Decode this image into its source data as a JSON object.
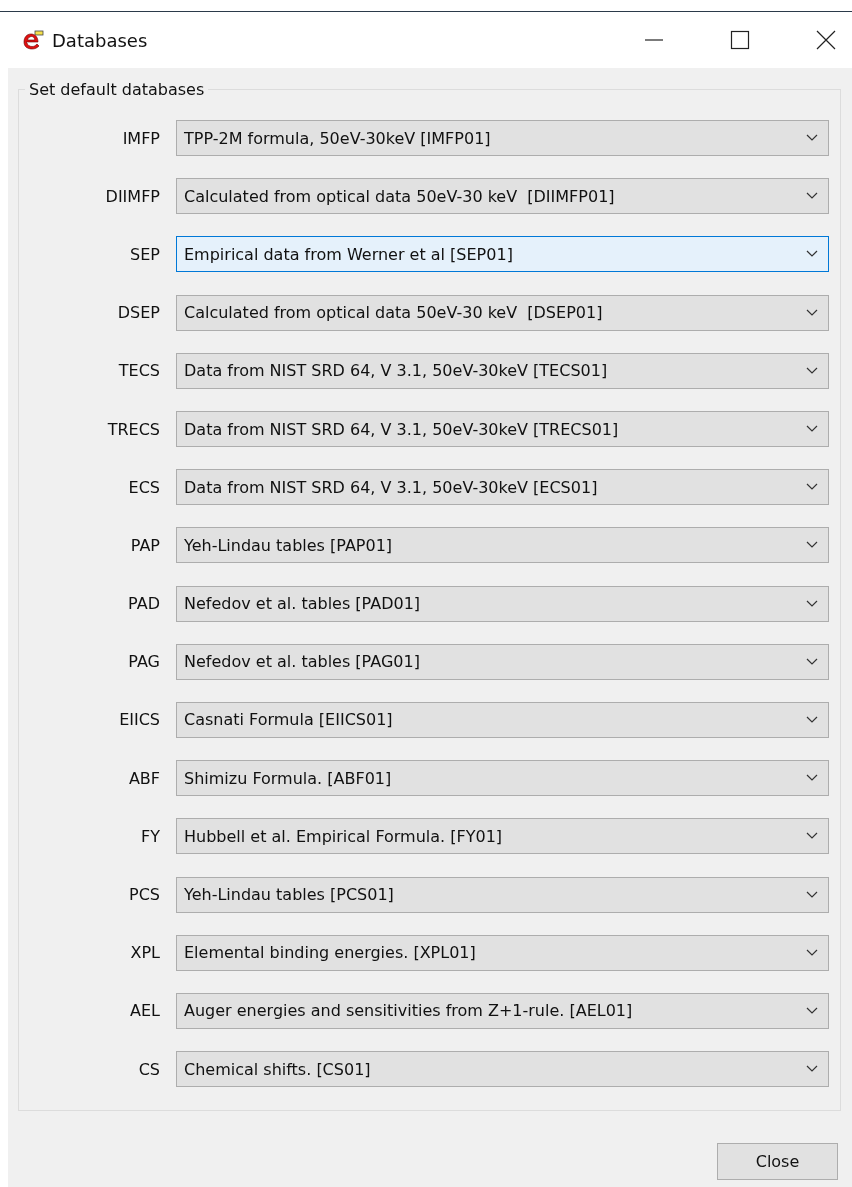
{
  "window": {
    "title": "Databases"
  },
  "group": {
    "title": "Set default databases"
  },
  "rows": [
    {
      "label": "IMFP",
      "value": "TPP-2M formula, 50eV-30keV [IMFP01]",
      "focused": false
    },
    {
      "label": "DIIMFP",
      "value": "Calculated from optical data 50eV-30 keV  [DIIMFP01]",
      "focused": false
    },
    {
      "label": "SEP",
      "value": "Empirical data from Werner et al [SEP01]",
      "focused": true
    },
    {
      "label": "DSEP",
      "value": "Calculated from optical data 50eV-30 keV  [DSEP01]",
      "focused": false
    },
    {
      "label": "TECS",
      "value": "Data from NIST SRD 64, V 3.1, 50eV-30keV [TECS01]",
      "focused": false
    },
    {
      "label": "TRECS",
      "value": "Data from NIST SRD 64, V 3.1, 50eV-30keV [TRECS01]",
      "focused": false
    },
    {
      "label": "ECS",
      "value": "Data from NIST SRD 64, V 3.1, 50eV-30keV [ECS01]",
      "focused": false
    },
    {
      "label": "PAP",
      "value": "Yeh-Lindau tables [PAP01]",
      "focused": false
    },
    {
      "label": "PAD",
      "value": "Nefedov et al. tables [PAD01]",
      "focused": false
    },
    {
      "label": "PAG",
      "value": "Nefedov et al. tables [PAG01]",
      "focused": false
    },
    {
      "label": "EIICS",
      "value": "Casnati Formula [EIICS01]",
      "focused": false
    },
    {
      "label": "ABF",
      "value": "Shimizu Formula. [ABF01]",
      "focused": false
    },
    {
      "label": "FY",
      "value": "Hubbell et al. Empirical Formula. [FY01]",
      "focused": false
    },
    {
      "label": "PCS",
      "value": "Yeh-Lindau tables [PCS01]",
      "focused": false
    },
    {
      "label": "XPL",
      "value": "Elemental binding energies. [XPL01]",
      "focused": false
    },
    {
      "label": "AEL",
      "value": "Auger energies and sensitivities from Z+1-rule. [AEL01]",
      "focused": false
    },
    {
      "label": "CS",
      "value": "Chemical shifts. [CS01]",
      "focused": false
    }
  ],
  "buttons": [
    "Close"
  ]
}
